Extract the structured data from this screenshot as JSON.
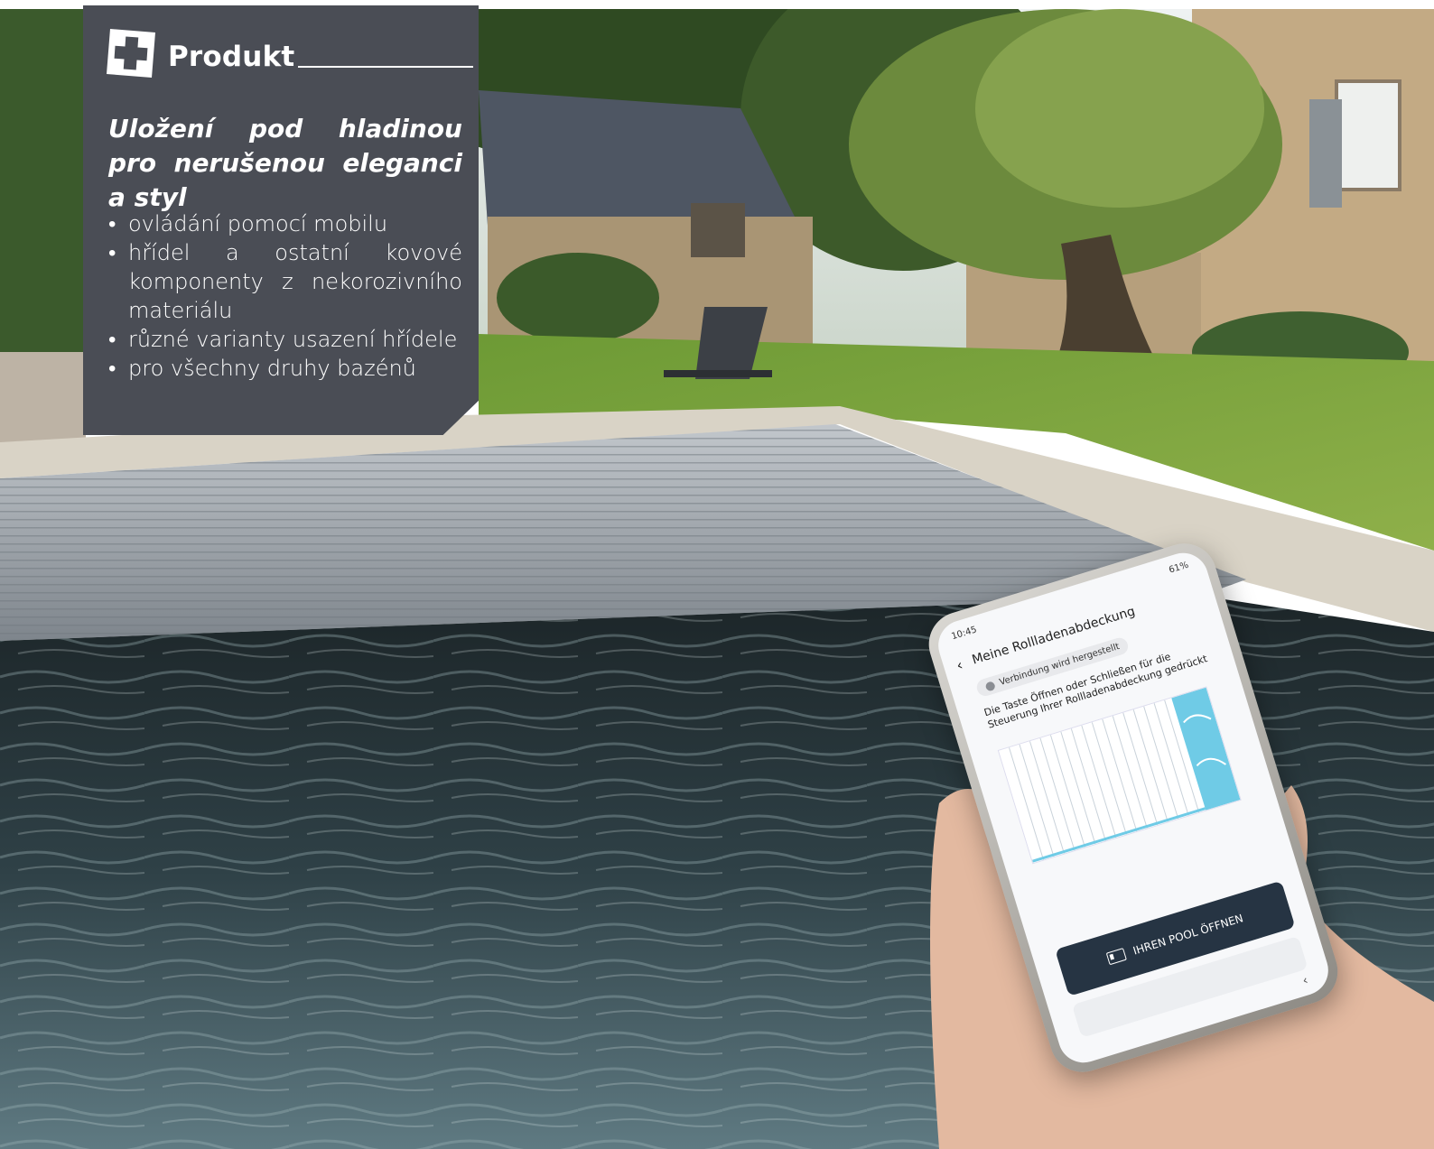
{
  "panel": {
    "logo_icon": "plus-square-icon",
    "heading": "Produkt",
    "subtitle": "Uložení pod hladinou pro nerušenou eleganci a styl",
    "bullets": [
      "ovládání pomocí mobilu",
      "hřídel a ostatní kovové komponenty z nekorozivního materiálu",
      "různé varianty usazení hřídele",
      "pro všechny druhy bazénů"
    ],
    "background_color": "#4a4d55"
  },
  "phone": {
    "status_time": "10:45",
    "status_battery": "61%",
    "screen_title": "Meine Rollladenabdeckung",
    "connection_status": "Verbindung wird hergestellt",
    "instruction": "Die Taste Öffnen oder Schließen für die Steuerung Ihrer Rollladenabdeckung gedrückt",
    "open_button_label": "IHREN POOL ÖFFNEN",
    "button_color": "#263443"
  },
  "scene": {
    "colors": {
      "sky": "#e9eef0",
      "foliage": "#3f5a2c",
      "lawn": "#6f9a3a",
      "stone": "#b89f7a",
      "roof": "#4e5663",
      "pool_cover": "#9aa1a8",
      "water": "#1e2a2e"
    }
  }
}
